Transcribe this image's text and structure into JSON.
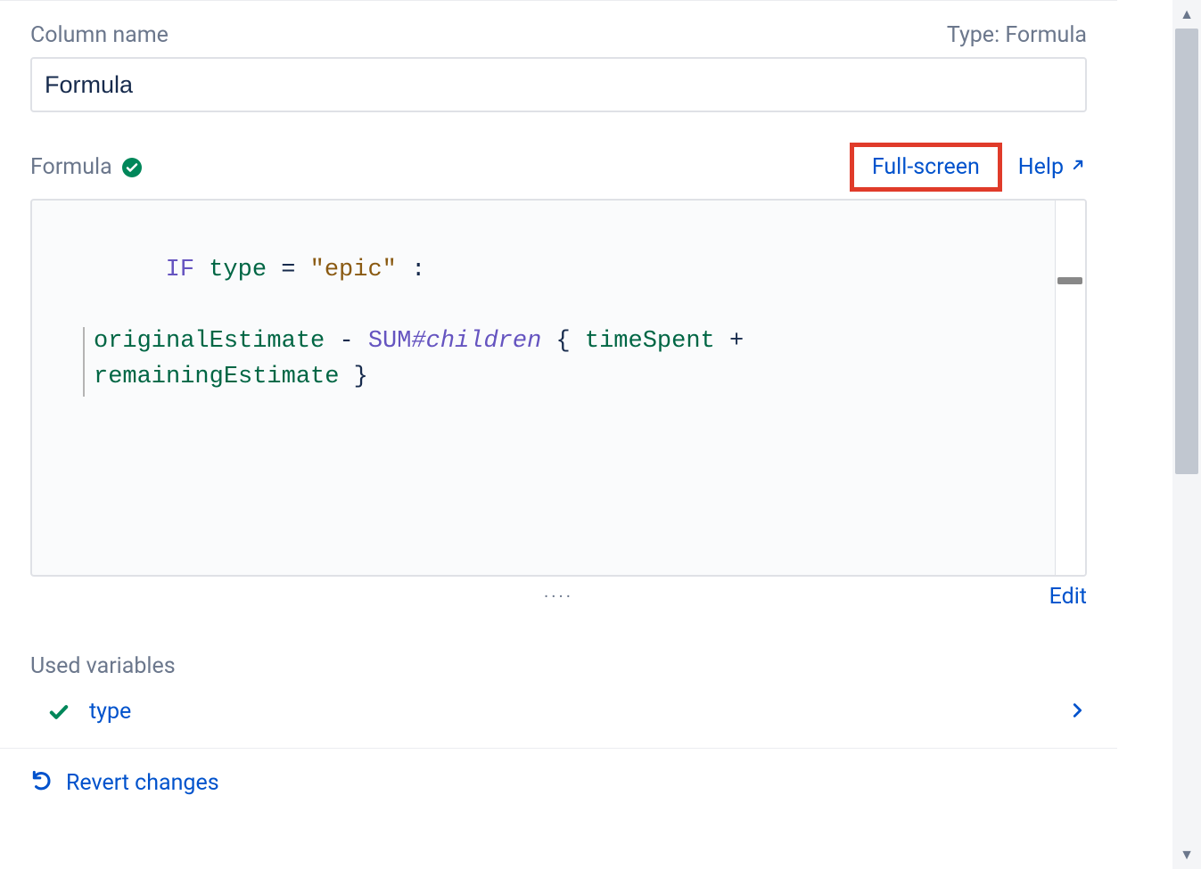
{
  "header": {
    "column_name_label": "Column name",
    "type_label": "Type: Formula"
  },
  "name_input": {
    "value": "Formula"
  },
  "formula_section": {
    "label": "Formula",
    "fullscreen_label": "Full-screen",
    "help_label": "Help"
  },
  "formula_code": {
    "tokens_line1": {
      "kw": "IF",
      "var": "type",
      "op1": "=",
      "str": "\"epic\"",
      "op2": ":"
    },
    "tokens_line2": {
      "var1": "originalEstimate",
      "op1": "-",
      "fn": "SUM",
      "hash": "#",
      "it": "children",
      "brace_open": "{",
      "var2": "timeSpent",
      "op2": "+"
    },
    "tokens_line3": {
      "var": "remainingEstimate",
      "brace_close": "}"
    }
  },
  "under_editor": {
    "dots": "····",
    "edit_label": "Edit"
  },
  "variables": {
    "section_label": "Used variables",
    "items": [
      {
        "name": "type"
      }
    ]
  },
  "footer": {
    "revert_label": "Revert changes"
  }
}
